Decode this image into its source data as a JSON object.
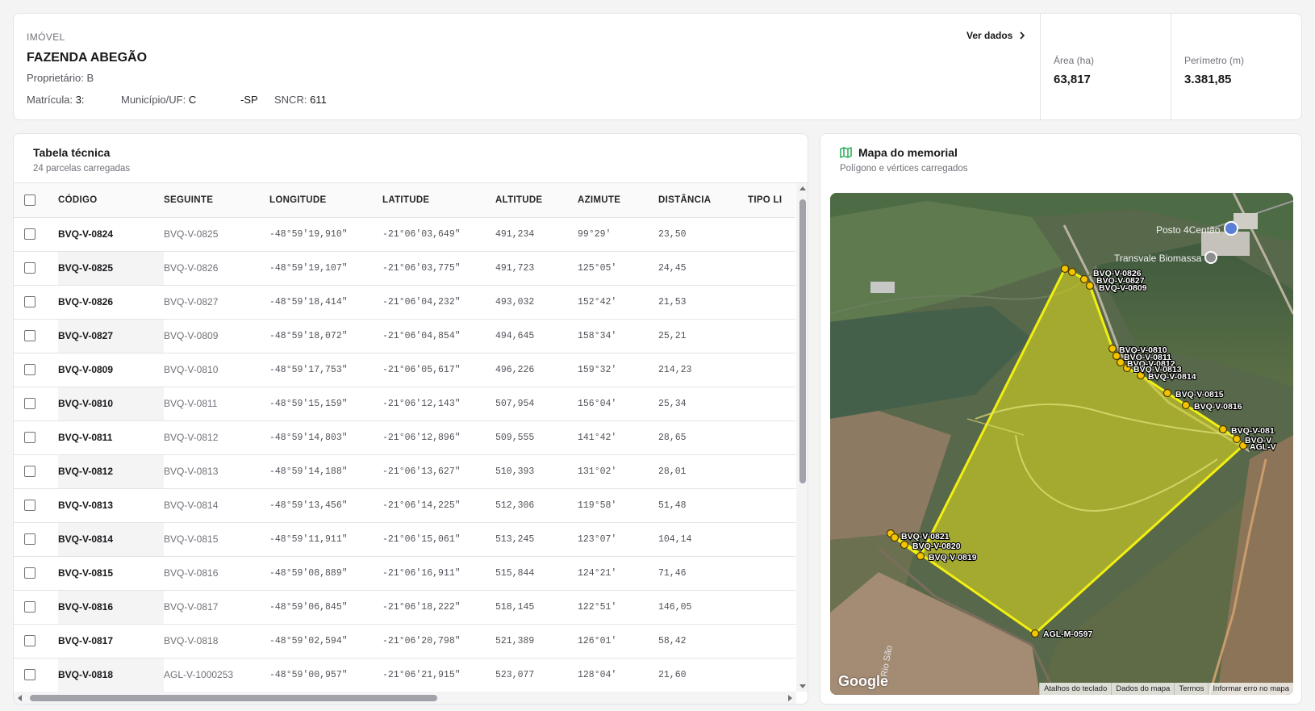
{
  "property": {
    "label": "IMÓVEL",
    "name": "FAZENDA ABEGÃO",
    "owner_label": "Proprietário:",
    "owner_value": "B",
    "matricula_label": "Matrícula:",
    "matricula_value": "3:",
    "municipio_label": "Município/UF:",
    "municipio_value": "C",
    "municipio_suffix": "-SP",
    "sncr_label": "SNCR:",
    "sncr_value": "611",
    "ver_dados": "Ver dados",
    "area_label": "Área (ha)",
    "area_value": "63,817",
    "perimetro_label": "Perímetro (m)",
    "perimetro_value": "3.381,85"
  },
  "table": {
    "title": "Tabela técnica",
    "subtitle": "24 parcelas carregadas",
    "columns": [
      "CÓDIGO",
      "SEGUINTE",
      "LONGITUDE",
      "LATITUDE",
      "ALTITUDE",
      "AZIMUTE",
      "DISTÂNCIA",
      "TIPO LI"
    ],
    "rows": [
      [
        "BVQ-V-0824",
        "BVQ-V-0825",
        "-48°59'19,910\"",
        "-21°06'03,649\"",
        "491,234",
        "99°29'",
        "23,50"
      ],
      [
        "BVQ-V-0825",
        "BVQ-V-0826",
        "-48°59'19,107\"",
        "-21°06'03,775\"",
        "491,723",
        "125°05'",
        "24,45"
      ],
      [
        "BVQ-V-0826",
        "BVQ-V-0827",
        "-48°59'18,414\"",
        "-21°06'04,232\"",
        "493,032",
        "152°42'",
        "21,53"
      ],
      [
        "BVQ-V-0827",
        "BVQ-V-0809",
        "-48°59'18,072\"",
        "-21°06'04,854\"",
        "494,645",
        "158°34'",
        "25,21"
      ],
      [
        "BVQ-V-0809",
        "BVQ-V-0810",
        "-48°59'17,753\"",
        "-21°06'05,617\"",
        "496,226",
        "159°32'",
        "214,23"
      ],
      [
        "BVQ-V-0810",
        "BVQ-V-0811",
        "-48°59'15,159\"",
        "-21°06'12,143\"",
        "507,954",
        "156°04'",
        "25,34"
      ],
      [
        "BVQ-V-0811",
        "BVQ-V-0812",
        "-48°59'14,803\"",
        "-21°06'12,896\"",
        "509,555",
        "141°42'",
        "28,65"
      ],
      [
        "BVQ-V-0812",
        "BVQ-V-0813",
        "-48°59'14,188\"",
        "-21°06'13,627\"",
        "510,393",
        "131°02'",
        "28,01"
      ],
      [
        "BVQ-V-0813",
        "BVQ-V-0814",
        "-48°59'13,456\"",
        "-21°06'14,225\"",
        "512,306",
        "119°58'",
        "51,48"
      ],
      [
        "BVQ-V-0814",
        "BVQ-V-0815",
        "-48°59'11,911\"",
        "-21°06'15,061\"",
        "513,245",
        "123°07'",
        "104,14"
      ],
      [
        "BVQ-V-0815",
        "BVQ-V-0816",
        "-48°59'08,889\"",
        "-21°06'16,911\"",
        "515,844",
        "124°21'",
        "71,46"
      ],
      [
        "BVQ-V-0816",
        "BVQ-V-0817",
        "-48°59'06,845\"",
        "-21°06'18,222\"",
        "518,145",
        "122°51'",
        "146,05"
      ],
      [
        "BVQ-V-0817",
        "BVQ-V-0818",
        "-48°59'02,594\"",
        "-21°06'20,798\"",
        "521,389",
        "126°01'",
        "58,42"
      ],
      [
        "BVQ-V-0818",
        "AGL-V-1000253",
        "-48°59'00,957\"",
        "-21°06'21,915\"",
        "523,077",
        "128°04'",
        "21,60"
      ]
    ]
  },
  "map": {
    "title": "Mapa do memorial",
    "subtitle": "Polígono e vértices carregados",
    "labels": {
      "posto": "Posto 4Centão",
      "transvale": "Transvale Biomassa",
      "rio": "Rio São",
      "google": "Google"
    },
    "vertex_labels": {
      "v0826": "BVQ-V-0826",
      "v0827": "BVQ-V-0827",
      "v0809": "BVQ-V-0809",
      "v0810": "BVQ-V-0810",
      "v0811": "BVQ-V-0811",
      "v0812": "BVQ-V-0812",
      "v0813": "BVQ-V-0813",
      "v0814": "BVQ-V-0814",
      "v0815": "BVQ-V-0815",
      "v0816": "BVQ-V-0816",
      "v0817": "BVQ-V-081",
      "v0818": "BVQ-V",
      "agl_v": "AGL-V",
      "v0821": "BVQ-V-0821",
      "v0820": "BVQ-V-0820",
      "v0819": "BVQ-V-0819",
      "aglm": "AGL-M-0597"
    },
    "footer": [
      "Atalhos do teclado",
      "Dados do mapa",
      "Termos",
      "Informar erro no mapa"
    ],
    "colors": {
      "polygon_fill": "#d4d41e",
      "polygon_stroke": "#f2ef12",
      "vertex": "#f5c400"
    }
  }
}
